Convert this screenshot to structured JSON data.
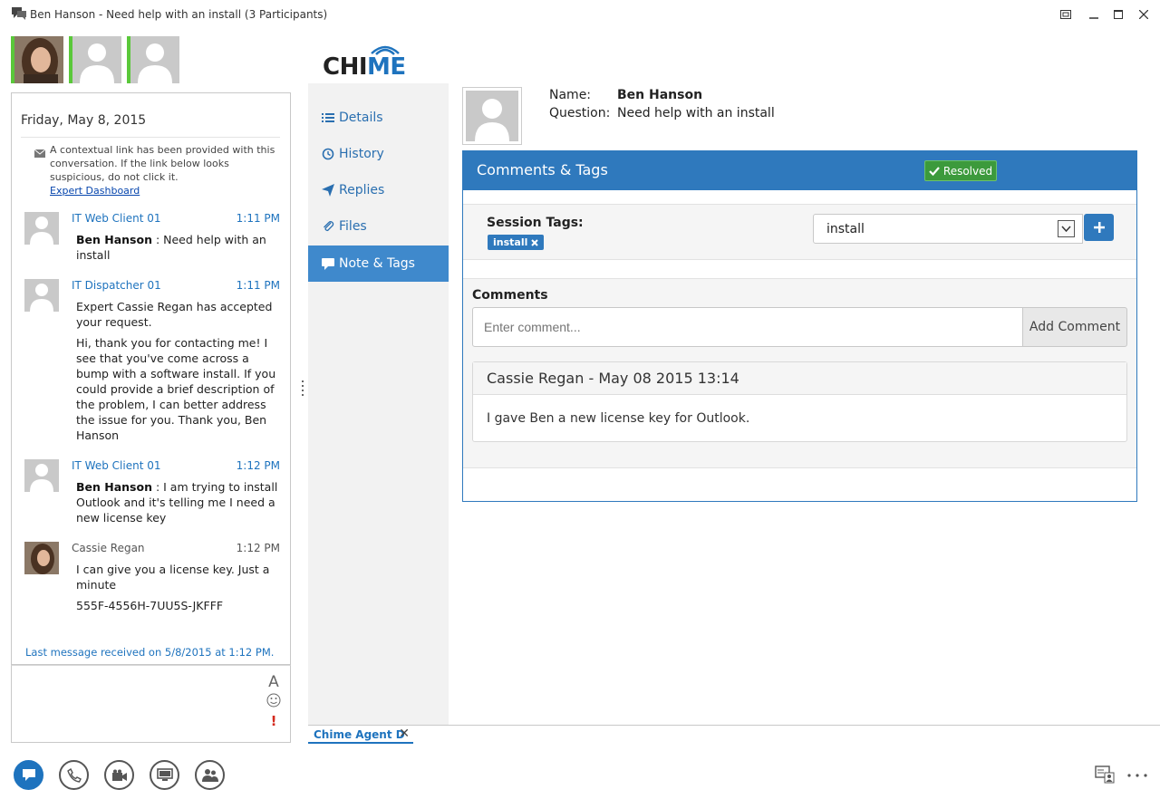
{
  "window": {
    "title": "Ben Hanson - Need help with an install (3 Participants)"
  },
  "conversation": {
    "date": "Friday, May 8, 2015",
    "notice": "A contextual link has been provided with this conversation. If the link below looks suspicious, do not click it.",
    "notice_link": "Expert Dashboard",
    "messages": [
      {
        "sender": "IT Web Client 01",
        "time": "1:11 PM",
        "bold": "Ben Hanson",
        "text": " : Need help with an install"
      },
      {
        "sender": "IT Dispatcher 01",
        "time": "1:11 PM",
        "p1": "Expert Cassie Regan has accepted your request.",
        "p2": "Hi, thank you for contacting me! I see that you've come across a bump with a software install. If you could provide a brief description of the problem, I can better address the issue for you. Thank you, Ben Hanson"
      },
      {
        "sender": "IT Web Client 01",
        "time": "1:12 PM",
        "bold": "Ben Hanson",
        "text": " : I am trying to install Outlook and it's telling me I need a new license key"
      },
      {
        "sender": "Cassie Regan",
        "time": "1:12 PM",
        "p1": "I can give you a license key. Just a minute",
        "p2": "555F-4556H-7UU5S-JKFFF"
      }
    ],
    "last_message": "Last message received on 5/8/2015 at 1:12 PM."
  },
  "chime": {
    "logo_prefix": "CHI",
    "logo_suffix": "ME",
    "nav": [
      {
        "label": "Details",
        "icon": "list-icon"
      },
      {
        "label": "History",
        "icon": "history-icon"
      },
      {
        "label": "Replies",
        "icon": "send-icon"
      },
      {
        "label": "Files",
        "icon": "paperclip-icon"
      },
      {
        "label": "Note & Tags",
        "icon": "comment-icon",
        "active": true
      }
    ],
    "profile": {
      "name_label": "Name:",
      "name_value": "Ben Hanson",
      "question_label": "Question:",
      "question_value": "Need help with an install"
    },
    "panel": {
      "title": "Comments & Tags",
      "status": "Resolved",
      "session_tags_label": "Session Tags:",
      "tag": "install",
      "tag_select_value": "install",
      "comments_label": "Comments",
      "comment_placeholder": "Enter comment...",
      "add_comment": "Add Comment",
      "comment": {
        "header": "Cassie Regan - May 08 2015 13:14",
        "body": "I gave Ben a new license key for Outlook."
      }
    }
  },
  "tabs": [
    {
      "label": "Chime Agent D"
    }
  ],
  "colors": {
    "accent": "#1e73be",
    "panel_blue": "#2f79bd",
    "resolved_green": "#3c9a3c",
    "presence_green": "#5ac83a"
  }
}
